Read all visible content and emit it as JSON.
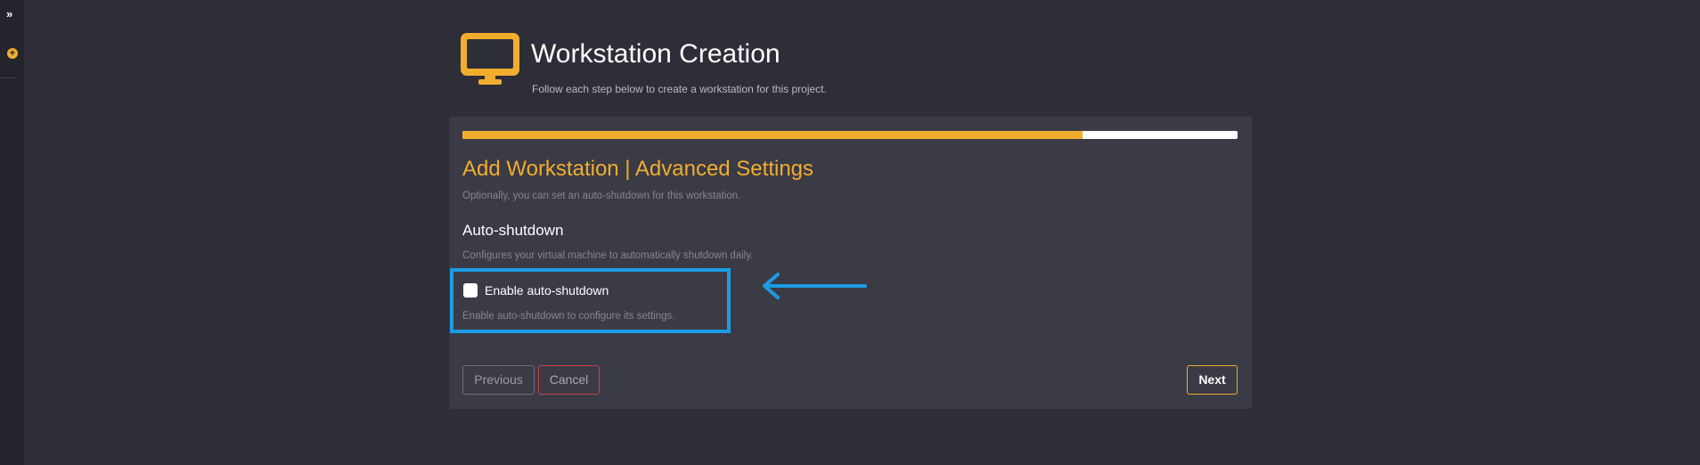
{
  "header": {
    "title": "Workstation Creation",
    "subtitle": "Follow each step below to create a workstation for this project.",
    "icon": "monitor-icon"
  },
  "progress": {
    "fraction": 0.8
  },
  "step": {
    "title": "Add Workstation | Advanced Settings",
    "description": "Optionally, you can set an auto-shutdown for this workstation."
  },
  "auto_shutdown": {
    "title": "Auto-shutdown",
    "description": "Configures your virtual machine to automatically shutdown daily.",
    "checkbox_label": "Enable auto-shutdown",
    "checkbox_checked": false,
    "help": "Enable auto-shutdown to configure its settings."
  },
  "buttons": {
    "previous": "Previous",
    "cancel": "Cancel",
    "next": "Next"
  },
  "sidebar": {
    "expand_icon": "double-chevron-right-icon",
    "add_icon": "plus-circle-icon"
  },
  "colors": {
    "accent": "#f2ad2f",
    "background": "#2d2e37",
    "card": "#3a3b45",
    "annotation": "#1b9ce3",
    "danger": "#c64343"
  }
}
